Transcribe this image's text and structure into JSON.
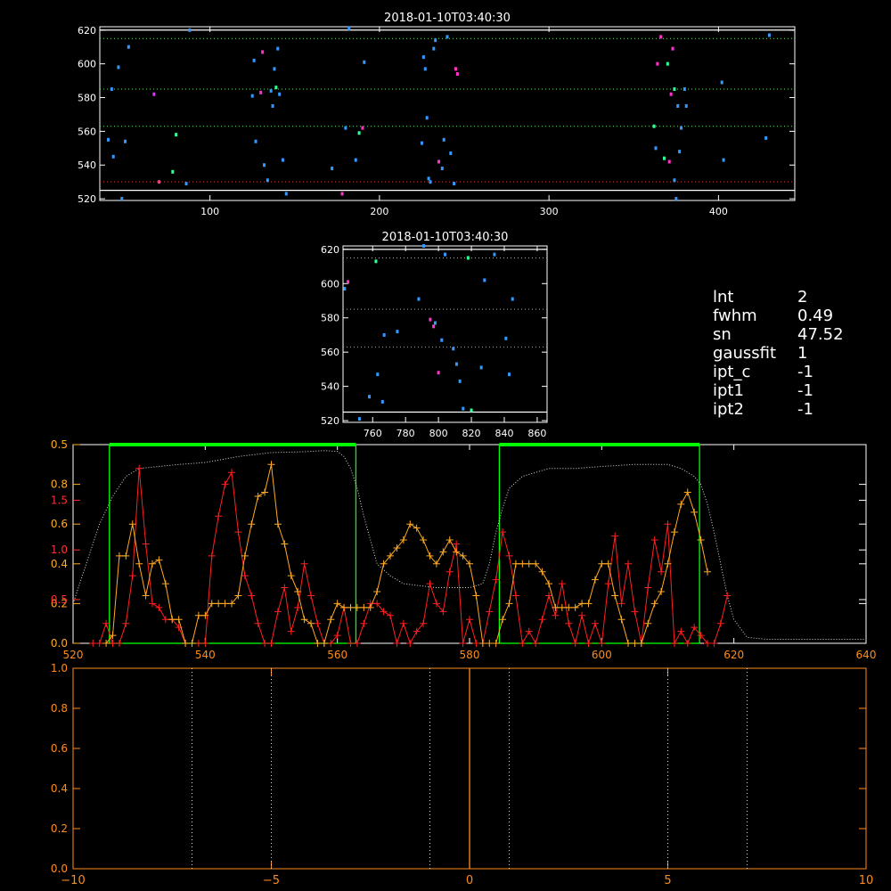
{
  "colors": {
    "background": "#000000",
    "axis_white": "#ffffff",
    "axis_orange": "#ff8c1a",
    "red_series": "#ff2020",
    "orange_series": "#ffaa22",
    "green": "#00ff00",
    "dotted_green": "#66dd66",
    "dotted_red": "#dd3333",
    "white_dotted": "#dddddd"
  },
  "info_panel": [
    {
      "key": "lnt",
      "value": "2"
    },
    {
      "key": "fwhm",
      "value": "0.49"
    },
    {
      "key": "sn",
      "value": "47.52"
    },
    {
      "key": "gaussfit",
      "value": "1"
    },
    {
      "key": "ipt_c",
      "value": "-1"
    },
    {
      "key": "ipt1",
      "value": "-1"
    },
    {
      "key": "ipt2",
      "value": "-1"
    }
  ],
  "chart_data": [
    {
      "id": "top-scatter",
      "type": "scatter",
      "title": "2018-01-10T03:40:30",
      "xlim": [
        35,
        445
      ],
      "ylim": [
        519,
        622
      ],
      "xticks": [
        100,
        200,
        300,
        400
      ],
      "yticks": [
        520,
        540,
        560,
        580,
        600,
        620
      ],
      "hlines_green_dotted": [
        615,
        585,
        563
      ],
      "hlines_red_dotted": [
        530
      ],
      "hlines_white_solid": [
        620,
        525
      ],
      "points": [
        {
          "x": 40,
          "y": 555,
          "c": "#3399ff"
        },
        {
          "x": 42,
          "y": 585,
          "c": "#3399ff"
        },
        {
          "x": 43,
          "y": 545,
          "c": "#3399ff"
        },
        {
          "x": 46,
          "y": 598,
          "c": "#3399ff"
        },
        {
          "x": 48,
          "y": 520,
          "c": "#3399ff"
        },
        {
          "x": 50,
          "y": 554,
          "c": "#3399ff"
        },
        {
          "x": 52,
          "y": 610,
          "c": "#3399ff"
        },
        {
          "x": 67,
          "y": 582,
          "c": "#dd33ff"
        },
        {
          "x": 70,
          "y": 530,
          "c": "#ff3399"
        },
        {
          "x": 78,
          "y": 536,
          "c": "#33ff99"
        },
        {
          "x": 80,
          "y": 558,
          "c": "#33ff99"
        },
        {
          "x": 86,
          "y": 529,
          "c": "#3399ff"
        },
        {
          "x": 88,
          "y": 620,
          "c": "#3399ff"
        },
        {
          "x": 125,
          "y": 581,
          "c": "#3399ff"
        },
        {
          "x": 126,
          "y": 602,
          "c": "#3399ff"
        },
        {
          "x": 127,
          "y": 554,
          "c": "#3399ff"
        },
        {
          "x": 130,
          "y": 583,
          "c": "#ff33cc"
        },
        {
          "x": 131,
          "y": 607,
          "c": "#ff33cc"
        },
        {
          "x": 132,
          "y": 540,
          "c": "#3399ff"
        },
        {
          "x": 134,
          "y": 531,
          "c": "#3399ff"
        },
        {
          "x": 136,
          "y": 584,
          "c": "#3399ff"
        },
        {
          "x": 137,
          "y": 575,
          "c": "#3399ff"
        },
        {
          "x": 138,
          "y": 597,
          "c": "#3399ff"
        },
        {
          "x": 139,
          "y": 586,
          "c": "#33ff99"
        },
        {
          "x": 140,
          "y": 609,
          "c": "#3399ff"
        },
        {
          "x": 141,
          "y": 582,
          "c": "#3399ff"
        },
        {
          "x": 143,
          "y": 543,
          "c": "#3399ff"
        },
        {
          "x": 145,
          "y": 523,
          "c": "#3399ff"
        },
        {
          "x": 172,
          "y": 538,
          "c": "#3399ff"
        },
        {
          "x": 178,
          "y": 523,
          "c": "#ff33cc"
        },
        {
          "x": 180,
          "y": 562,
          "c": "#3399ff"
        },
        {
          "x": 182,
          "y": 621,
          "c": "#3399ff"
        },
        {
          "x": 186,
          "y": 543,
          "c": "#3399ff"
        },
        {
          "x": 188,
          "y": 559,
          "c": "#33ff99"
        },
        {
          "x": 190,
          "y": 562,
          "c": "#ff33cc"
        },
        {
          "x": 191,
          "y": 601,
          "c": "#3399ff"
        },
        {
          "x": 225,
          "y": 553,
          "c": "#3399ff"
        },
        {
          "x": 226,
          "y": 604,
          "c": "#3399ff"
        },
        {
          "x": 227,
          "y": 597,
          "c": "#3399ff"
        },
        {
          "x": 228,
          "y": 568,
          "c": "#3399ff"
        },
        {
          "x": 229,
          "y": 532,
          "c": "#3399ff"
        },
        {
          "x": 230,
          "y": 530,
          "c": "#3399ff"
        },
        {
          "x": 232,
          "y": 609,
          "c": "#3399ff"
        },
        {
          "x": 233,
          "y": 614,
          "c": "#3399ff"
        },
        {
          "x": 235,
          "y": 542,
          "c": "#ff33cc"
        },
        {
          "x": 237,
          "y": 538,
          "c": "#3399ff"
        },
        {
          "x": 238,
          "y": 555,
          "c": "#3399ff"
        },
        {
          "x": 240,
          "y": 616,
          "c": "#3399ff"
        },
        {
          "x": 242,
          "y": 547,
          "c": "#3399ff"
        },
        {
          "x": 244,
          "y": 529,
          "c": "#3399ff"
        },
        {
          "x": 245,
          "y": 597,
          "c": "#ff33cc"
        },
        {
          "x": 246,
          "y": 594,
          "c": "#ff33cc"
        },
        {
          "x": 362,
          "y": 563,
          "c": "#33ff99"
        },
        {
          "x": 363,
          "y": 550,
          "c": "#3399ff"
        },
        {
          "x": 364,
          "y": 600,
          "c": "#ff33cc"
        },
        {
          "x": 366,
          "y": 616,
          "c": "#ff33cc"
        },
        {
          "x": 368,
          "y": 544,
          "c": "#33ff99"
        },
        {
          "x": 370,
          "y": 600,
          "c": "#33ff99"
        },
        {
          "x": 371,
          "y": 542,
          "c": "#ff33cc"
        },
        {
          "x": 372,
          "y": 582,
          "c": "#ff33cc"
        },
        {
          "x": 373,
          "y": 609,
          "c": "#ff33cc"
        },
        {
          "x": 374,
          "y": 585,
          "c": "#33ff99"
        },
        {
          "x": 376,
          "y": 575,
          "c": "#3399ff"
        },
        {
          "x": 377,
          "y": 548,
          "c": "#3399ff"
        },
        {
          "x": 378,
          "y": 562,
          "c": "#3399ff"
        },
        {
          "x": 380,
          "y": 585,
          "c": "#3399ff"
        },
        {
          "x": 381,
          "y": 575,
          "c": "#3399ff"
        },
        {
          "x": 402,
          "y": 589,
          "c": "#3399ff"
        },
        {
          "x": 403,
          "y": 543,
          "c": "#3399ff"
        },
        {
          "x": 428,
          "y": 556,
          "c": "#3399ff"
        },
        {
          "x": 430,
          "y": 617,
          "c": "#3399ff"
        },
        {
          "x": 374,
          "y": 531,
          "c": "#3399ff"
        },
        {
          "x": 375,
          "y": 520,
          "c": "#3399ff"
        }
      ]
    },
    {
      "id": "zoom-scatter",
      "type": "scatter",
      "title": "2018-01-10T03:40:30",
      "xlim": [
        742,
        866
      ],
      "ylim": [
        519,
        622
      ],
      "xticks": [
        760,
        780,
        800,
        820,
        840,
        860
      ],
      "yticks": [
        520,
        540,
        560,
        580,
        600,
        620
      ],
      "hlines_green_dotted": [
        615,
        585,
        563
      ],
      "hlines_white_solid": [
        620,
        525
      ],
      "points": [
        {
          "x": 743,
          "y": 597,
          "c": "#3399ff"
        },
        {
          "x": 745,
          "y": 601,
          "c": "#ff33cc"
        },
        {
          "x": 752,
          "y": 521,
          "c": "#3399ff"
        },
        {
          "x": 758,
          "y": 534,
          "c": "#3399ff"
        },
        {
          "x": 762,
          "y": 613,
          "c": "#33ff99"
        },
        {
          "x": 763,
          "y": 547,
          "c": "#3399ff"
        },
        {
          "x": 766,
          "y": 531,
          "c": "#3399ff"
        },
        {
          "x": 767,
          "y": 570,
          "c": "#3399ff"
        },
        {
          "x": 775,
          "y": 572,
          "c": "#3399ff"
        },
        {
          "x": 788,
          "y": 591,
          "c": "#3399ff"
        },
        {
          "x": 791,
          "y": 622,
          "c": "#3399ff"
        },
        {
          "x": 795,
          "y": 579,
          "c": "#ff33cc"
        },
        {
          "x": 797,
          "y": 575,
          "c": "#ff33cc"
        },
        {
          "x": 798,
          "y": 577,
          "c": "#3399ff"
        },
        {
          "x": 800,
          "y": 548,
          "c": "#ff33cc"
        },
        {
          "x": 802,
          "y": 567,
          "c": "#3399ff"
        },
        {
          "x": 804,
          "y": 617,
          "c": "#3399ff"
        },
        {
          "x": 809,
          "y": 562,
          "c": "#3399ff"
        },
        {
          "x": 811,
          "y": 553,
          "c": "#3399ff"
        },
        {
          "x": 813,
          "y": 543,
          "c": "#3399ff"
        },
        {
          "x": 815,
          "y": 527,
          "c": "#3399ff"
        },
        {
          "x": 818,
          "y": 615,
          "c": "#33ff99"
        },
        {
          "x": 820,
          "y": 526,
          "c": "#33ff99"
        },
        {
          "x": 826,
          "y": 551,
          "c": "#3399ff"
        },
        {
          "x": 828,
          "y": 602,
          "c": "#3399ff"
        },
        {
          "x": 834,
          "y": 617,
          "c": "#3399ff"
        },
        {
          "x": 841,
          "y": 568,
          "c": "#3399ff"
        },
        {
          "x": 843,
          "y": 547,
          "c": "#3399ff"
        },
        {
          "x": 845,
          "y": 591,
          "c": "#3399ff"
        }
      ]
    },
    {
      "id": "profile-plot",
      "type": "line",
      "xlim": [
        520,
        640
      ],
      "ylim": [
        0,
        0.5
      ],
      "xticks": [
        520,
        540,
        560,
        580,
        600,
        620,
        640
      ],
      "ytick_sets": [
        {
          "color": "#ffaa22",
          "labels": [
            "0.0",
            "0.2",
            "0.4",
            "0.6",
            "0.8",
            "0.5"
          ],
          "values": [
            0,
            0.1,
            0.2,
            0.3,
            0.4,
            0.5
          ]
        },
        {
          "color": "#ff3030",
          "labels": [
            "0.5",
            "1.0",
            "1.5"
          ],
          "values": [
            0.11,
            0.235,
            0.36
          ]
        }
      ],
      "green_boxes": [
        [
          525.5,
          562.8
        ],
        [
          584.5,
          614.8
        ]
      ],
      "white_dotted_curve": {
        "x": [
          520,
          522,
          524,
          526,
          528,
          530,
          533,
          536,
          540,
          545,
          550,
          555,
          558,
          560,
          561,
          562,
          563,
          564,
          565,
          566,
          568,
          570,
          575,
          580,
          582,
          583,
          584,
          585,
          586,
          588,
          592,
          596,
          600,
          605,
          610,
          612,
          613,
          614,
          615,
          616,
          617,
          618,
          619,
          620,
          622,
          625,
          630,
          640
        ],
        "y": [
          0.1,
          0.2,
          0.3,
          0.37,
          0.42,
          0.44,
          0.445,
          0.45,
          0.455,
          0.47,
          0.48,
          0.482,
          0.485,
          0.483,
          0.47,
          0.44,
          0.39,
          0.32,
          0.26,
          0.2,
          0.17,
          0.15,
          0.14,
          0.14,
          0.15,
          0.2,
          0.28,
          0.34,
          0.39,
          0.42,
          0.44,
          0.44,
          0.445,
          0.45,
          0.45,
          0.44,
          0.43,
          0.42,
          0.4,
          0.35,
          0.28,
          0.2,
          0.12,
          0.06,
          0.015,
          0.01,
          0.01,
          0.01
        ]
      },
      "red_series": {
        "x": [
          523,
          524,
          525,
          526,
          527,
          528,
          529,
          530,
          531,
          532,
          533,
          534,
          535,
          536,
          537,
          538,
          539,
          540,
          541,
          542,
          543,
          544,
          545,
          546,
          547,
          548,
          549,
          550,
          551,
          552,
          553,
          554,
          555,
          556,
          557,
          558,
          559,
          560,
          561,
          562,
          563,
          564,
          565,
          566,
          567,
          568,
          569,
          570,
          571,
          572,
          573,
          574,
          575,
          576,
          577,
          578,
          579,
          580,
          581,
          582,
          583,
          584,
          585,
          586,
          587,
          588,
          589,
          590,
          591,
          592,
          593,
          594,
          595,
          596,
          597,
          598,
          599,
          600,
          601,
          602,
          603,
          604,
          605,
          606,
          607,
          608,
          609,
          610,
          611,
          612,
          613,
          614,
          615,
          616,
          617,
          618,
          619
        ],
        "y": [
          0.0,
          0.0,
          0.05,
          0.0,
          0.0,
          0.05,
          0.17,
          0.44,
          0.25,
          0.1,
          0.09,
          0.06,
          0.06,
          0.04,
          0.0,
          0.0,
          0.0,
          0.0,
          0.22,
          0.32,
          0.4,
          0.43,
          0.28,
          0.17,
          0.12,
          0.05,
          0.0,
          0.0,
          0.08,
          0.14,
          0.03,
          0.09,
          0.2,
          0.12,
          0.05,
          0.0,
          0.0,
          0.02,
          0.09,
          0.0,
          0.0,
          0.05,
          0.1,
          0.1,
          0.08,
          0.07,
          0.0,
          0.05,
          0.0,
          0.03,
          0.05,
          0.15,
          0.1,
          0.08,
          0.18,
          0.25,
          0.0,
          0.06,
          0.0,
          0.0,
          0.08,
          0.16,
          0.28,
          0.22,
          0.12,
          0.0,
          0.03,
          0.0,
          0.06,
          0.12,
          0.07,
          0.15,
          0.05,
          0.0,
          0.07,
          0.0,
          0.05,
          0.0,
          0.15,
          0.27,
          0.1,
          0.2,
          0.08,
          0.0,
          0.14,
          0.26,
          0.18,
          0.3,
          0.0,
          0.03,
          0.0,
          0.04,
          0.02,
          0.0,
          0.0,
          0.05,
          0.12
        ]
      },
      "orange_series": {
        "x": [
          525,
          526,
          527,
          528,
          529,
          530,
          531,
          532,
          533,
          534,
          535,
          536,
          537,
          538,
          539,
          540,
          541,
          542,
          543,
          544,
          545,
          546,
          547,
          548,
          549,
          550,
          551,
          552,
          553,
          554,
          555,
          556,
          557,
          558,
          559,
          560,
          561,
          562,
          563,
          564,
          565,
          566,
          567,
          568,
          569,
          570,
          571,
          572,
          573,
          574,
          575,
          576,
          577,
          578,
          579,
          580,
          581,
          582,
          583,
          584,
          585,
          586,
          587,
          588,
          589,
          590,
          591,
          592,
          593,
          594,
          595,
          596,
          597,
          598,
          599,
          600,
          601,
          602,
          603,
          604,
          605,
          606,
          607,
          608,
          609,
          610,
          611,
          612,
          613,
          614,
          615,
          616,
          617,
          618
        ],
        "y": [
          0.0,
          0.02,
          0.22,
          0.22,
          0.3,
          0.2,
          0.12,
          0.2,
          0.21,
          0.15,
          0.06,
          0.06,
          0.0,
          0.0,
          0.07,
          0.07,
          0.1,
          0.1,
          0.1,
          0.1,
          0.12,
          0.22,
          0.3,
          0.37,
          0.38,
          0.45,
          0.3,
          0.25,
          0.17,
          0.13,
          0.06,
          0.05,
          0.0,
          0.0,
          0.06,
          0.1,
          0.09,
          0.09,
          0.09,
          0.09,
          0.09,
          0.13,
          0.2,
          0.22,
          0.24,
          0.26,
          0.3,
          0.29,
          0.26,
          0.22,
          0.2,
          0.23,
          0.26,
          0.23,
          0.22,
          0.2,
          0.12,
          0.0,
          0.0,
          0.0,
          0.06,
          0.1,
          0.2,
          0.2,
          0.2,
          0.2,
          0.18,
          0.15,
          0.09,
          0.09,
          0.09,
          0.09,
          0.1,
          0.1,
          0.16,
          0.2,
          0.2,
          0.12,
          0.06,
          0.0,
          0.0,
          0.0,
          0.05,
          0.1,
          0.13,
          0.2,
          0.28,
          0.35,
          0.38,
          0.33,
          0.26,
          0.18
        ]
      }
    },
    {
      "id": "lag-plot",
      "type": "line",
      "xlim": [
        -10,
        10
      ],
      "ylim": [
        0,
        1
      ],
      "xticks": [
        -10,
        -5,
        0,
        5,
        10
      ],
      "yticks": [
        0.0,
        0.2,
        0.4,
        0.6,
        0.8,
        1.0
      ],
      "ytick_labels": [
        "0.0",
        "0.2",
        "0.4",
        "0.6",
        "0.8",
        "1.0"
      ],
      "xtick_labels": [
        "−10",
        "−5",
        "0",
        "5",
        "10"
      ],
      "vlines_dotted": [
        -7,
        -5,
        -1,
        1,
        5,
        7
      ],
      "vline_solid": [
        0
      ]
    }
  ]
}
